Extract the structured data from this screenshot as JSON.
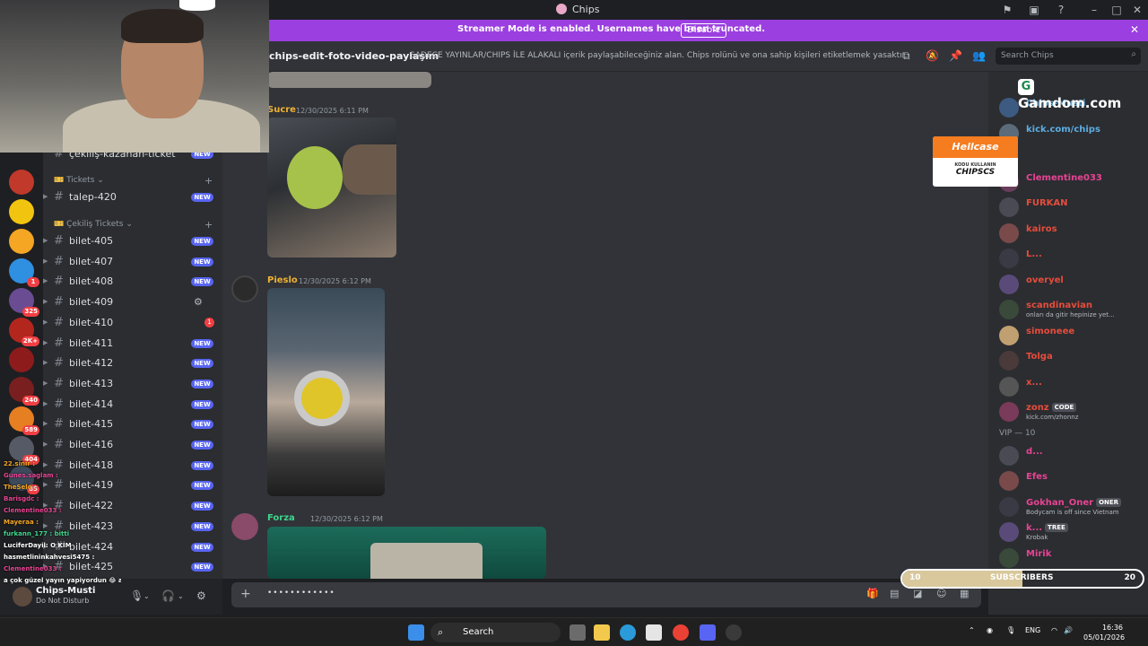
{
  "window": {
    "title": "Chips"
  },
  "banner": {
    "message": "Streamer Mode is enabled. Usernames have been truncated.",
    "disable_label": "Disable"
  },
  "channel_header": {
    "name": "chips-edit-foto-video-paylaşım",
    "topic": "SADECE YAYINLAR/CHIPS İLE ALAKALI içerik paylaşabileceğiniz alan. Chips rolünü ve ona sahip kişileri etiketlemek yasaktır.",
    "search_placeholder": "Search Chips"
  },
  "servers": [
    {
      "color": "#c0392b",
      "badge": ""
    },
    {
      "color": "#f1c40f",
      "badge": ""
    },
    {
      "color": "#f5a623",
      "badge": ""
    },
    {
      "color": "#2f8fe0",
      "badge": "1"
    },
    {
      "color": "#6a4c93",
      "badge": "325"
    },
    {
      "color": "#b3261e",
      "badge": "2K+"
    },
    {
      "color": "#8e1b1b",
      "badge": ""
    },
    {
      "color": "#7a1f1f",
      "badge": "240"
    },
    {
      "color": "#e67e22",
      "badge": "589"
    },
    {
      "color": "#555a66",
      "badge": "404"
    },
    {
      "color": "#3d4a5c",
      "badge": "85"
    }
  ],
  "channels": {
    "partial_top": "çekiliş-kazanan-ticket",
    "cat_tickets": "Tickets",
    "cat_cekilis": "Çekiliş Tickets",
    "new_label": "NEW",
    "ticket": "talep-420",
    "items": [
      {
        "label": "bilet-405",
        "status": "new"
      },
      {
        "label": "bilet-407",
        "status": "new"
      },
      {
        "label": "bilet-408",
        "status": "new"
      },
      {
        "label": "bilet-409",
        "status": "gear"
      },
      {
        "label": "bilet-410",
        "status": "red",
        "count": "1"
      },
      {
        "label": "bilet-411",
        "status": "new"
      },
      {
        "label": "bilet-412",
        "status": "new"
      },
      {
        "label": "bilet-413",
        "status": "new"
      },
      {
        "label": "bilet-414",
        "status": "new"
      },
      {
        "label": "bilet-415",
        "status": "new"
      },
      {
        "label": "bilet-416",
        "status": "new"
      },
      {
        "label": "bilet-418",
        "status": "new"
      },
      {
        "label": "bilet-419",
        "status": "new"
      },
      {
        "label": "bilet-422",
        "status": "new"
      },
      {
        "label": "bilet-423",
        "status": "new"
      },
      {
        "label": "bilet-424",
        "status": "new"
      },
      {
        "label": "bilet-425",
        "status": "new"
      }
    ]
  },
  "user_panel": {
    "name": "Chips-Musti",
    "status": "Do Not Disturb"
  },
  "stream_chat": [
    {
      "text": "22.sinir :",
      "color": "#f5a623"
    },
    {
      "text": "Gunes.saglam :",
      "color": "#e84393"
    },
    {
      "text": "TheSelo :",
      "color": "#f5a623"
    },
    {
      "text": "Barisgdc :",
      "color": "#e84393"
    },
    {
      "text": "Clementine033 :",
      "color": "#e84393"
    },
    {
      "text": "Mayeraa :",
      "color": "#f5a623"
    },
    {
      "text": "furkann_177 : bitti",
      "color": "#3dd68c"
    },
    {
      "text": "LuciferDayil: O KİM",
      "color": "#ffffff"
    },
    {
      "text": "hasmetlininkahvesi5475 :",
      "color": "#ffffff"
    },
    {
      "text": "Clementine033 :",
      "color": "#e84393"
    },
    {
      "text": "a çok güzel yayın yapiyordun 😂 asas",
      "color": "#ffffff"
    }
  ],
  "messages": [
    {
      "author": "Sucre",
      "time": "12/30/2025 6:11 PM",
      "color": "#f0b232"
    },
    {
      "author": "Pieslo",
      "time": "12/30/2025 6:12 PM",
      "color": "#f0b232"
    },
    {
      "author": "Forza",
      "time": "12/30/2025 6:12 PM",
      "color": "#3dd68c"
    }
  ],
  "composer": {
    "placeholder": "••••••••••••"
  },
  "members": {
    "top": [
      {
        "name": "Chips-Musti",
        "color": "#5dade2",
        "status": ""
      },
      {
        "name": "kick.com/chips",
        "color": "#5dade2",
        "status": ""
      },
      {
        "name": "Clementine033",
        "color": "#e84393",
        "status": ""
      },
      {
        "name": "FURKAN",
        "color": "#e74c3c",
        "status": ""
      },
      {
        "name": "kairos",
        "color": "#e74c3c",
        "status": ""
      },
      {
        "name": "L...",
        "color": "#e74c3c",
        "status": ""
      },
      {
        "name": "overyel",
        "color": "#e74c3c",
        "status": ""
      },
      {
        "name": "scandinavian",
        "color": "#e74c3c",
        "status": "onları da gitir hepinize yet..."
      },
      {
        "name": "simoneee",
        "color": "#e74c3c",
        "status": ""
      },
      {
        "name": "Tolga",
        "color": "#e74c3c",
        "status": ""
      },
      {
        "name": "x...",
        "color": "#e74c3c",
        "status": ""
      },
      {
        "name": "zonz",
        "color": "#e74c3c",
        "status": "kick.com/zhonnz",
        "tag": "CODE"
      }
    ],
    "vip_header": "VIP — 10",
    "vip": [
      {
        "name": "d...",
        "color": "#e84393",
        "status": ""
      },
      {
        "name": "Efes",
        "color": "#e84393",
        "status": ""
      },
      {
        "name": "Gokhan_Oner",
        "color": "#e84393",
        "status": "Bodycam is off since Vietnam",
        "tag": "ONER"
      },
      {
        "name": "k...",
        "color": "#e84393",
        "status": "Krobak",
        "tag": "TREE"
      },
      {
        "name": "Mirik",
        "color": "#e84393",
        "status": ""
      }
    ]
  },
  "sponsors": {
    "gamdom": "Gamdom.com",
    "hellcase_title": "Hellcase",
    "hellcase_line1": "KODU KULLANIN",
    "hellcase_line2": "CHIPSCS"
  },
  "subs_bar": {
    "label": "SUBSCRIBERS",
    "current": "10",
    "goal": "20",
    "progress": 0.5
  },
  "taskbar": {
    "search_label": "Search",
    "lang": "ENG",
    "time": "16:36",
    "date": "05/01/2026"
  }
}
